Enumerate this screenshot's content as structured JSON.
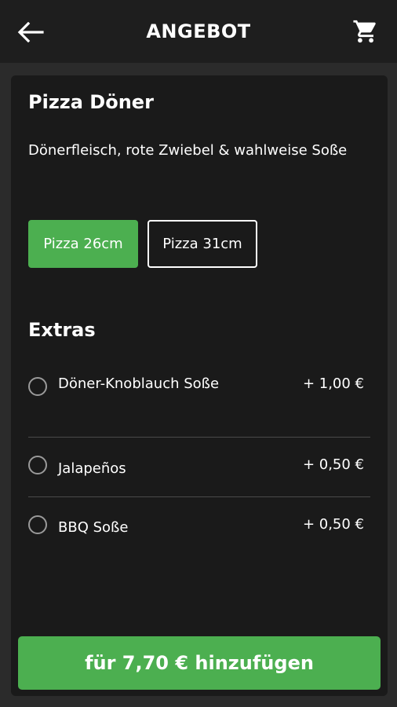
{
  "header": {
    "title": "ANGEBOT",
    "back_icon": "arrow-left-icon",
    "cart_icon": "shopping-cart-icon"
  },
  "product": {
    "name": "Pizza Döner",
    "description": "Dönerfleisch, rote Zwiebel & wahlweise Soße",
    "sizes": [
      {
        "label": "Pizza 26cm",
        "selected": true
      },
      {
        "label": "Pizza 31cm",
        "selected": false
      }
    ]
  },
  "extras": {
    "title": "Extras",
    "items": [
      {
        "label": "Döner-Knoblauch Soße",
        "price": "+ 1,00 €",
        "checked": false
      },
      {
        "label": "Jalapeños",
        "price": "+ 0,50 €",
        "checked": false
      },
      {
        "label": "BBQ Soße",
        "price": "+ 0,50 €",
        "checked": false
      }
    ]
  },
  "add_button": {
    "label": "für 7,70 € hinzufügen"
  },
  "colors": {
    "accent": "#4caf50",
    "background": "#2b2b2b",
    "card": "#1a1a1a",
    "appbar": "#1e1e1e"
  }
}
